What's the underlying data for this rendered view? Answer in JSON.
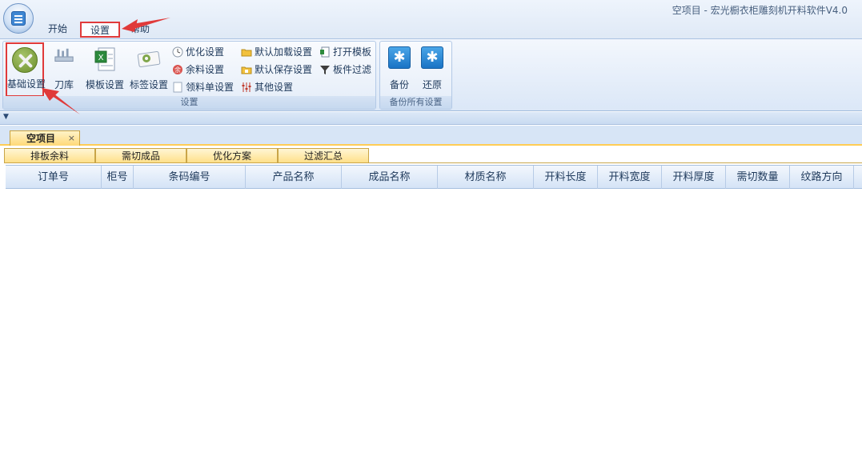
{
  "window": {
    "title": "空项目 - 宏光橱衣柜雕刻机开料软件V4.0"
  },
  "menu": {
    "start": "开始",
    "settings": "设置",
    "help": "帮助"
  },
  "ribbon": {
    "group_settings": {
      "caption": "设置",
      "basic": "基础设置",
      "tools": "刀库",
      "template": "模板设置",
      "label": "标签设置",
      "optimize": "优化设置",
      "remnant": "余料设置",
      "pick_list": "领料单设置",
      "default_load": "默认加载设置",
      "default_save": "默认保存设置",
      "other": "其他设置",
      "open_template": "打开模板",
      "board_filter": "板件过滤"
    },
    "group_backup": {
      "caption": "备份所有设置",
      "backup": "备份",
      "restore": "还原"
    }
  },
  "document": {
    "tab_label": "空项目",
    "close_symbol": "×",
    "inner_tabs": [
      "排板余料",
      "需切成品",
      "优化方案",
      "过滤汇总"
    ]
  },
  "grid": {
    "columns": [
      "订单号",
      "柜号",
      "条码编号",
      "产品名称",
      "成品名称",
      "材质名称",
      "开料长度",
      "开料宽度",
      "开料厚度",
      "需切数量",
      "纹路方向"
    ]
  },
  "colors": {
    "annotation": "#e03a3a",
    "accent_tab": "#ffd978"
  }
}
